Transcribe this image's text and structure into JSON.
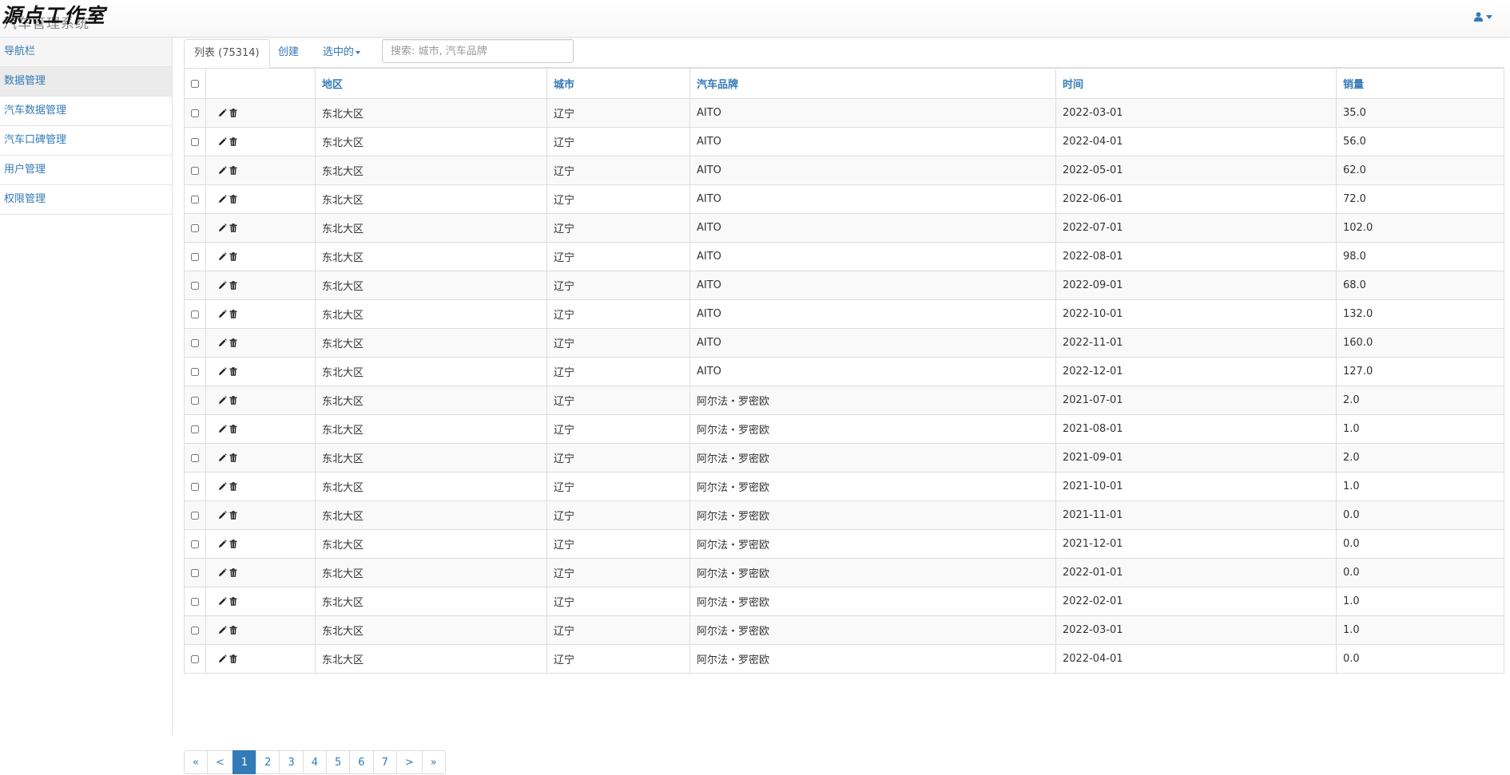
{
  "navbar": {
    "brand_text": "汽车管理系统",
    "watermark": "源点工作室"
  },
  "sidebar": {
    "items": [
      {
        "label": "导航栏"
      },
      {
        "label": "数据管理"
      },
      {
        "label": "汽车数据管理"
      },
      {
        "label": "汽车口碑管理"
      },
      {
        "label": "用户管理"
      },
      {
        "label": "权限管理"
      }
    ]
  },
  "tabs": {
    "list": "列表 (75314)",
    "create": "创建",
    "selected": "选中的"
  },
  "search": {
    "placeholder": "搜索: 城市, 汽车品牌"
  },
  "table": {
    "columns": [
      "地区",
      "城市",
      "汽车品牌",
      "时间",
      "销量"
    ],
    "rows": [
      [
        "东北大区",
        "辽宁",
        "AITO",
        "2022-03-01",
        "35.0"
      ],
      [
        "东北大区",
        "辽宁",
        "AITO",
        "2022-04-01",
        "56.0"
      ],
      [
        "东北大区",
        "辽宁",
        "AITO",
        "2022-05-01",
        "62.0"
      ],
      [
        "东北大区",
        "辽宁",
        "AITO",
        "2022-06-01",
        "72.0"
      ],
      [
        "东北大区",
        "辽宁",
        "AITO",
        "2022-07-01",
        "102.0"
      ],
      [
        "东北大区",
        "辽宁",
        "AITO",
        "2022-08-01",
        "98.0"
      ],
      [
        "东北大区",
        "辽宁",
        "AITO",
        "2022-09-01",
        "68.0"
      ],
      [
        "东北大区",
        "辽宁",
        "AITO",
        "2022-10-01",
        "132.0"
      ],
      [
        "东北大区",
        "辽宁",
        "AITO",
        "2022-11-01",
        "160.0"
      ],
      [
        "东北大区",
        "辽宁",
        "AITO",
        "2022-12-01",
        "127.0"
      ],
      [
        "东北大区",
        "辽宁",
        "阿尔法・罗密欧",
        "2021-07-01",
        "2.0"
      ],
      [
        "东北大区",
        "辽宁",
        "阿尔法・罗密欧",
        "2021-08-01",
        "1.0"
      ],
      [
        "东北大区",
        "辽宁",
        "阿尔法・罗密欧",
        "2021-09-01",
        "2.0"
      ],
      [
        "东北大区",
        "辽宁",
        "阿尔法・罗密欧",
        "2021-10-01",
        "1.0"
      ],
      [
        "东北大区",
        "辽宁",
        "阿尔法・罗密欧",
        "2021-11-01",
        "0.0"
      ],
      [
        "东北大区",
        "辽宁",
        "阿尔法・罗密欧",
        "2021-12-01",
        "0.0"
      ],
      [
        "东北大区",
        "辽宁",
        "阿尔法・罗密欧",
        "2022-01-01",
        "0.0"
      ],
      [
        "东北大区",
        "辽宁",
        "阿尔法・罗密欧",
        "2022-02-01",
        "1.0"
      ],
      [
        "东北大区",
        "辽宁",
        "阿尔法・罗密欧",
        "2022-03-01",
        "1.0"
      ],
      [
        "东北大区",
        "辽宁",
        "阿尔法・罗密欧",
        "2022-04-01",
        "0.0"
      ]
    ]
  },
  "pagination": {
    "first": "«",
    "prev": "<",
    "pages": [
      "1",
      "2",
      "3",
      "4",
      "5",
      "6",
      "7"
    ],
    "active": "1",
    "next": ">",
    "last": "»"
  },
  "icons": {
    "user": "user-icon",
    "edit": "pencil-icon",
    "delete": "trash-icon"
  },
  "colors": {
    "link": "#337ab7",
    "active_page": "#337ab7"
  }
}
